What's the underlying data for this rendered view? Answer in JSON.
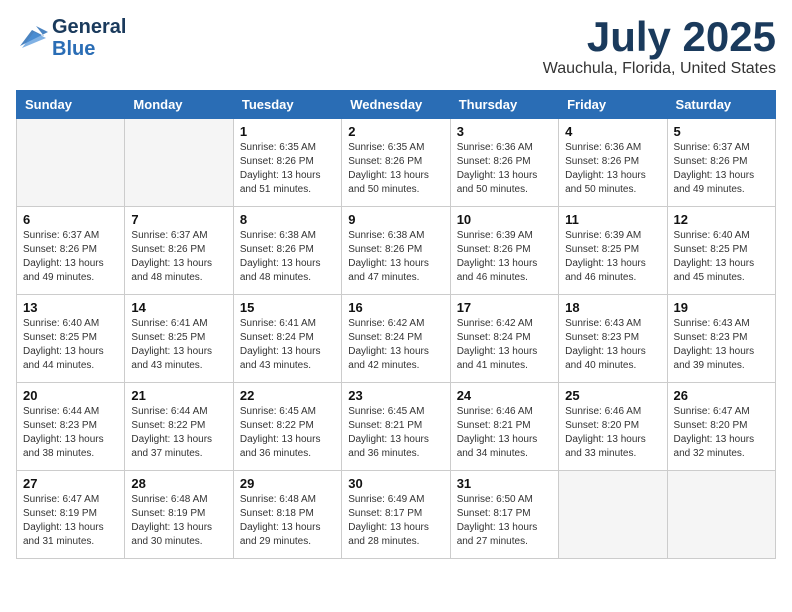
{
  "header": {
    "logo_line1": "General",
    "logo_line2": "Blue",
    "month": "July 2025",
    "location": "Wauchula, Florida, United States"
  },
  "weekdays": [
    "Sunday",
    "Monday",
    "Tuesday",
    "Wednesday",
    "Thursday",
    "Friday",
    "Saturday"
  ],
  "weeks": [
    [
      {
        "day": "",
        "info": ""
      },
      {
        "day": "",
        "info": ""
      },
      {
        "day": "1",
        "info": "Sunrise: 6:35 AM\nSunset: 8:26 PM\nDaylight: 13 hours\nand 51 minutes."
      },
      {
        "day": "2",
        "info": "Sunrise: 6:35 AM\nSunset: 8:26 PM\nDaylight: 13 hours\nand 50 minutes."
      },
      {
        "day": "3",
        "info": "Sunrise: 6:36 AM\nSunset: 8:26 PM\nDaylight: 13 hours\nand 50 minutes."
      },
      {
        "day": "4",
        "info": "Sunrise: 6:36 AM\nSunset: 8:26 PM\nDaylight: 13 hours\nand 50 minutes."
      },
      {
        "day": "5",
        "info": "Sunrise: 6:37 AM\nSunset: 8:26 PM\nDaylight: 13 hours\nand 49 minutes."
      }
    ],
    [
      {
        "day": "6",
        "info": "Sunrise: 6:37 AM\nSunset: 8:26 PM\nDaylight: 13 hours\nand 49 minutes."
      },
      {
        "day": "7",
        "info": "Sunrise: 6:37 AM\nSunset: 8:26 PM\nDaylight: 13 hours\nand 48 minutes."
      },
      {
        "day": "8",
        "info": "Sunrise: 6:38 AM\nSunset: 8:26 PM\nDaylight: 13 hours\nand 48 minutes."
      },
      {
        "day": "9",
        "info": "Sunrise: 6:38 AM\nSunset: 8:26 PM\nDaylight: 13 hours\nand 47 minutes."
      },
      {
        "day": "10",
        "info": "Sunrise: 6:39 AM\nSunset: 8:26 PM\nDaylight: 13 hours\nand 46 minutes."
      },
      {
        "day": "11",
        "info": "Sunrise: 6:39 AM\nSunset: 8:25 PM\nDaylight: 13 hours\nand 46 minutes."
      },
      {
        "day": "12",
        "info": "Sunrise: 6:40 AM\nSunset: 8:25 PM\nDaylight: 13 hours\nand 45 minutes."
      }
    ],
    [
      {
        "day": "13",
        "info": "Sunrise: 6:40 AM\nSunset: 8:25 PM\nDaylight: 13 hours\nand 44 minutes."
      },
      {
        "day": "14",
        "info": "Sunrise: 6:41 AM\nSunset: 8:25 PM\nDaylight: 13 hours\nand 43 minutes."
      },
      {
        "day": "15",
        "info": "Sunrise: 6:41 AM\nSunset: 8:24 PM\nDaylight: 13 hours\nand 43 minutes."
      },
      {
        "day": "16",
        "info": "Sunrise: 6:42 AM\nSunset: 8:24 PM\nDaylight: 13 hours\nand 42 minutes."
      },
      {
        "day": "17",
        "info": "Sunrise: 6:42 AM\nSunset: 8:24 PM\nDaylight: 13 hours\nand 41 minutes."
      },
      {
        "day": "18",
        "info": "Sunrise: 6:43 AM\nSunset: 8:23 PM\nDaylight: 13 hours\nand 40 minutes."
      },
      {
        "day": "19",
        "info": "Sunrise: 6:43 AM\nSunset: 8:23 PM\nDaylight: 13 hours\nand 39 minutes."
      }
    ],
    [
      {
        "day": "20",
        "info": "Sunrise: 6:44 AM\nSunset: 8:23 PM\nDaylight: 13 hours\nand 38 minutes."
      },
      {
        "day": "21",
        "info": "Sunrise: 6:44 AM\nSunset: 8:22 PM\nDaylight: 13 hours\nand 37 minutes."
      },
      {
        "day": "22",
        "info": "Sunrise: 6:45 AM\nSunset: 8:22 PM\nDaylight: 13 hours\nand 36 minutes."
      },
      {
        "day": "23",
        "info": "Sunrise: 6:45 AM\nSunset: 8:21 PM\nDaylight: 13 hours\nand 36 minutes."
      },
      {
        "day": "24",
        "info": "Sunrise: 6:46 AM\nSunset: 8:21 PM\nDaylight: 13 hours\nand 34 minutes."
      },
      {
        "day": "25",
        "info": "Sunrise: 6:46 AM\nSunset: 8:20 PM\nDaylight: 13 hours\nand 33 minutes."
      },
      {
        "day": "26",
        "info": "Sunrise: 6:47 AM\nSunset: 8:20 PM\nDaylight: 13 hours\nand 32 minutes."
      }
    ],
    [
      {
        "day": "27",
        "info": "Sunrise: 6:47 AM\nSunset: 8:19 PM\nDaylight: 13 hours\nand 31 minutes."
      },
      {
        "day": "28",
        "info": "Sunrise: 6:48 AM\nSunset: 8:19 PM\nDaylight: 13 hours\nand 30 minutes."
      },
      {
        "day": "29",
        "info": "Sunrise: 6:48 AM\nSunset: 8:18 PM\nDaylight: 13 hours\nand 29 minutes."
      },
      {
        "day": "30",
        "info": "Sunrise: 6:49 AM\nSunset: 8:17 PM\nDaylight: 13 hours\nand 28 minutes."
      },
      {
        "day": "31",
        "info": "Sunrise: 6:50 AM\nSunset: 8:17 PM\nDaylight: 13 hours\nand 27 minutes."
      },
      {
        "day": "",
        "info": ""
      },
      {
        "day": "",
        "info": ""
      }
    ]
  ]
}
